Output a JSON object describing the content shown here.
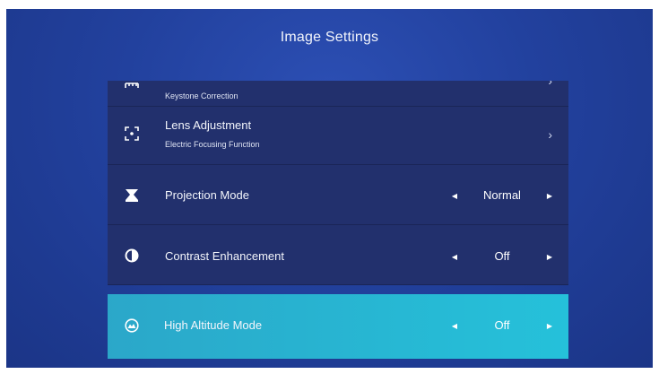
{
  "screen": {
    "title": "Image Settings"
  },
  "menu": {
    "items": [
      {
        "id": "keystone",
        "label": "Keystone Correction",
        "icon": "keystone-icon",
        "action": "›"
      },
      {
        "id": "lens",
        "label": "Lens Adjustment",
        "sublabel": "Electric Focusing Function",
        "icon": "focus-frame-icon",
        "action": "›"
      },
      {
        "id": "projection",
        "label": "Projection Mode",
        "icon": "projection-mode-icon",
        "value": "Normal",
        "prev": "◀",
        "next": "▶"
      },
      {
        "id": "contrast",
        "label": "Contrast Enhancement",
        "icon": "contrast-icon",
        "value": "Off",
        "prev": "◀",
        "next": "▶"
      },
      {
        "id": "altitude",
        "label": "High Altitude Mode",
        "icon": "altitude-icon",
        "value": "Off",
        "prev": "◀",
        "next": "▶",
        "selected": true
      }
    ]
  },
  "colors": {
    "background": "#22419e",
    "item_background": "#22306d",
    "selected_background": "#27b7d3",
    "text": "#ffffff"
  }
}
